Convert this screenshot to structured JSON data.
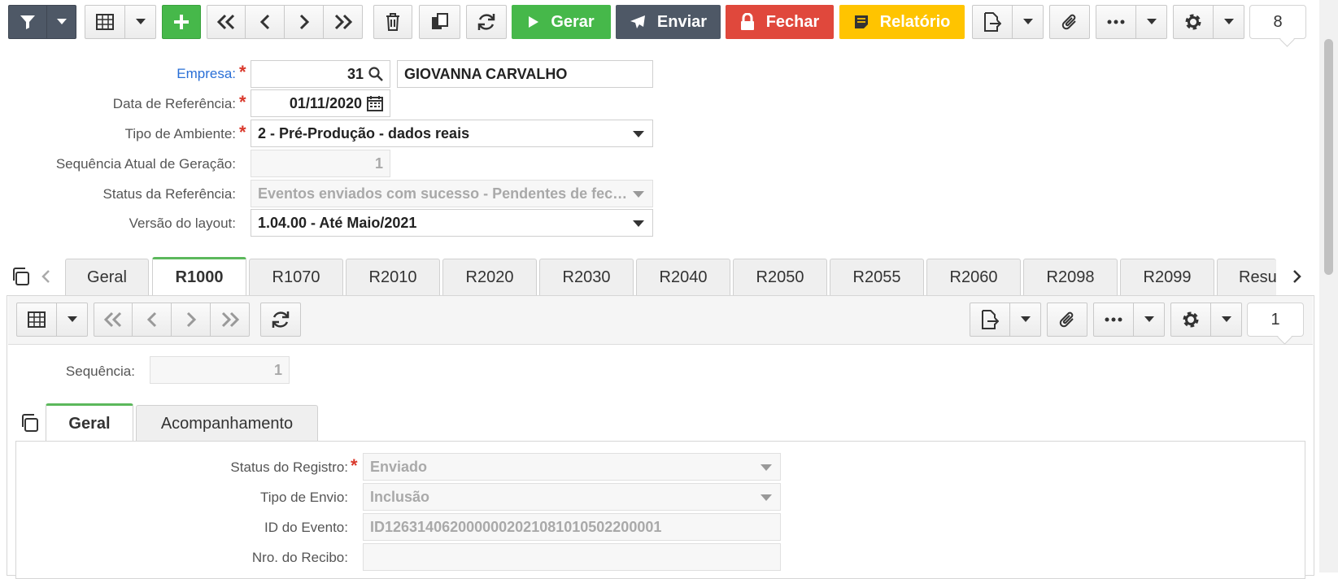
{
  "toolbar": {
    "actions": {
      "generate": "Gerar",
      "send": "Enviar",
      "close": "Fechar",
      "report": "Relatório"
    },
    "record_count": "8",
    "colors": {
      "generate": "#46b84a",
      "send": "#4e5866",
      "close": "#e0483c",
      "report": "#ffc400"
    }
  },
  "form": {
    "company": {
      "label": "Empresa:",
      "code": "31",
      "name": "GIOVANNA CARVALHO"
    },
    "reference_date": {
      "label": "Data de Referência:",
      "value": "01/11/2020"
    },
    "environment_type": {
      "label": "Tipo de Ambiente:",
      "value": "2 - Pré-Produção - dados reais"
    },
    "generation_sequence": {
      "label": "Sequência Atual de Geração:",
      "value": "1"
    },
    "reference_status": {
      "label": "Status da Referência:",
      "value": "Eventos enviados com sucesso - Pendentes de fechamento"
    },
    "layout_version": {
      "label": "Versão do layout:",
      "value": "1.04.00 - Até Maio/2021"
    }
  },
  "tabs": [
    "Geral",
    "R1000",
    "R1070",
    "R2010",
    "R2020",
    "R2030",
    "R2040",
    "R2050",
    "R2055",
    "R2060",
    "R2098",
    "R2099",
    "Resu"
  ],
  "active_tab": "R1000",
  "detail": {
    "record_count": "1",
    "sequence": {
      "label": "Sequência:",
      "value": "1"
    },
    "subtabs": [
      "Geral",
      "Acompanhamento"
    ],
    "active_subtab": "Geral",
    "fields": {
      "record_status": {
        "label": "Status do Registro:",
        "value": "Enviado"
      },
      "send_type": {
        "label": "Tipo de Envio:",
        "value": "Inclusão"
      },
      "event_id": {
        "label": "ID do Evento:",
        "value": "ID1263140620000002021081010502200001"
      },
      "receipt_number": {
        "label": "Nro. do Recibo:",
        "value": ""
      }
    }
  }
}
